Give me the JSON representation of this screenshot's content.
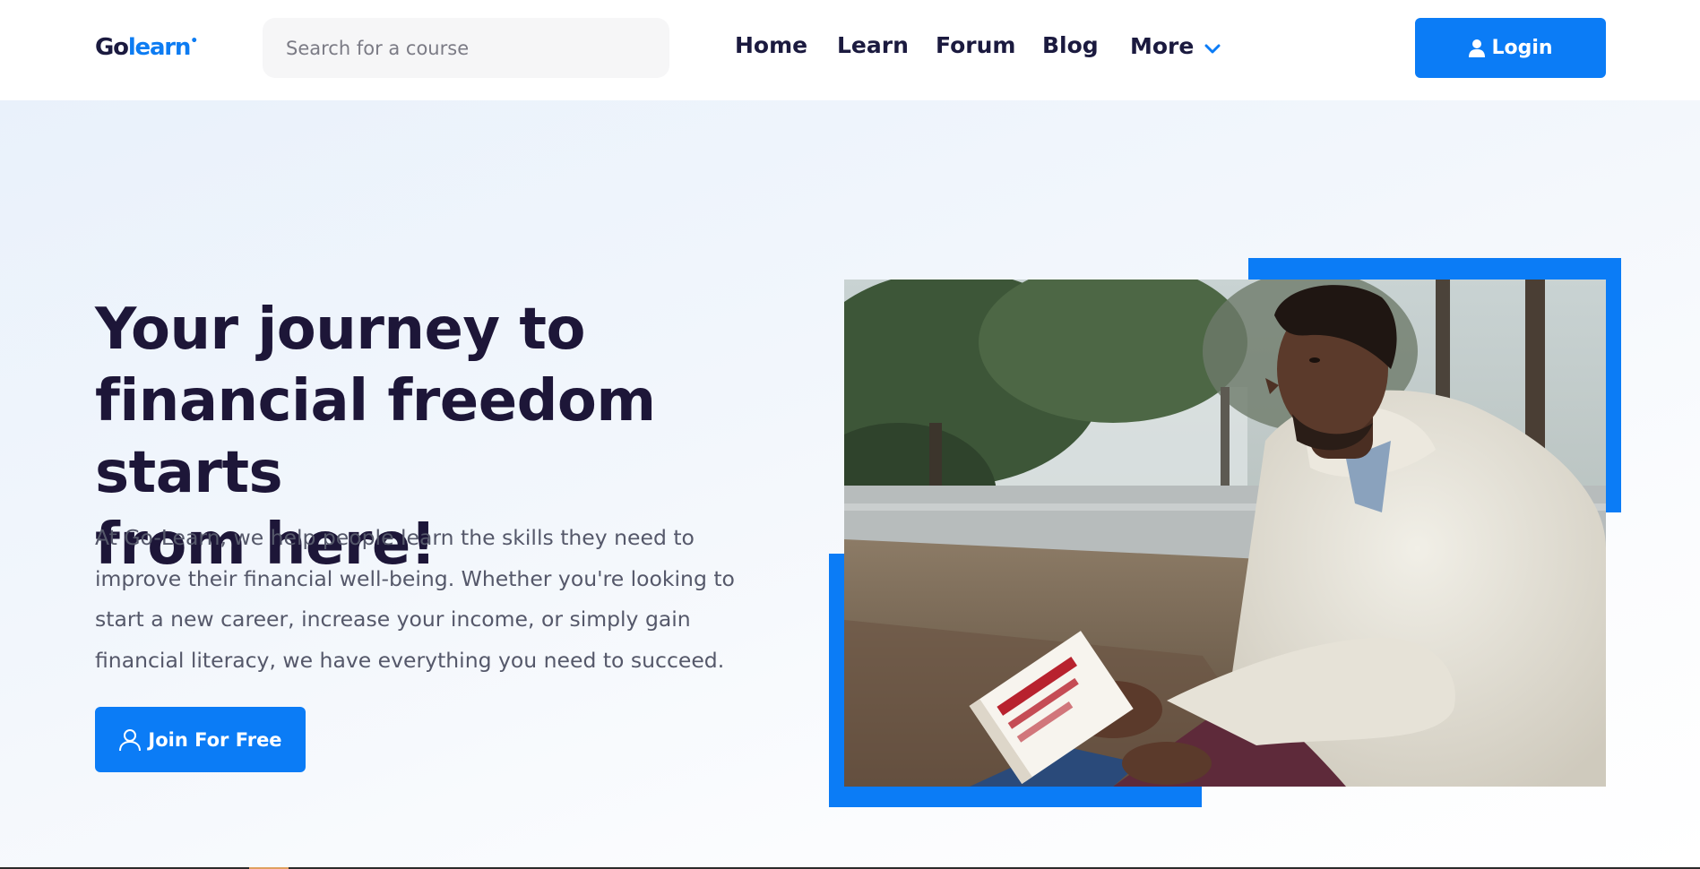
{
  "header": {
    "logo": {
      "part1": "Go",
      "part2": "learn",
      "mark": "•"
    },
    "search": {
      "placeholder": "Search for a course"
    },
    "nav": [
      {
        "label": "Home"
      },
      {
        "label": "Learn"
      },
      {
        "label": "Forum"
      },
      {
        "label": "Blog"
      },
      {
        "label": "More",
        "icon": "chevron-down-icon"
      }
    ],
    "login": {
      "label": "Login",
      "icon": "user-icon"
    }
  },
  "hero": {
    "headline_lines": [
      "Your journey to",
      "financial freedom starts",
      "from here!"
    ],
    "description_lines": [
      "At Go-Learn, we help people learn the skills they need to",
      "improve their financial well-being. Whether you're looking to",
      "start a new career, increase your income, or simply gain",
      "financial literacy, we have everything you need to succeed."
    ],
    "cta": {
      "label": "Join For Free",
      "icon": "user-outline-icon"
    },
    "image": {
      "subject": "man-reading-book-photo"
    }
  },
  "colors": {
    "primary": "#0b7cf6",
    "heading": "#1d1638",
    "nav_text": "#1b1a3f",
    "body_text": "#55586a",
    "search_bg": "#f6f6f7"
  }
}
